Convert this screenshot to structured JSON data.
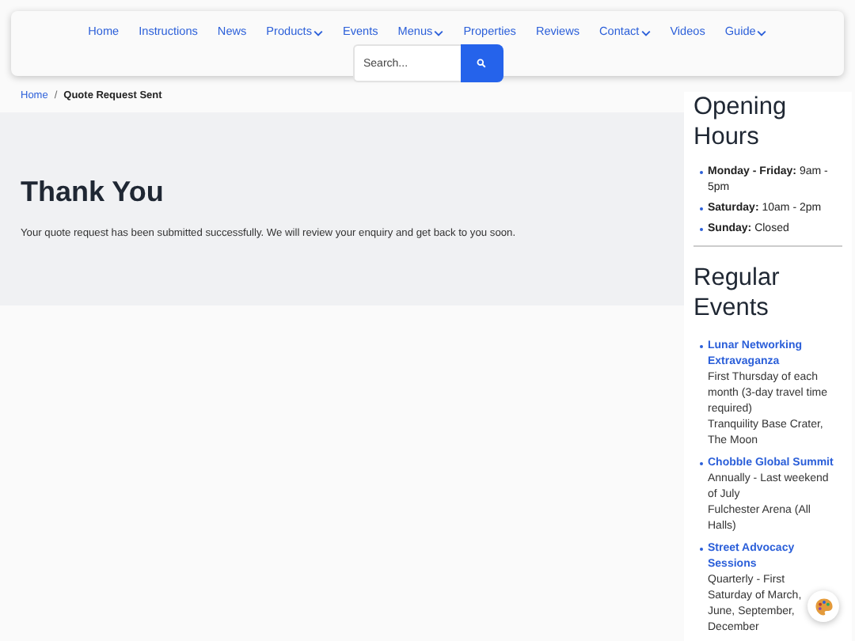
{
  "nav": {
    "items": [
      {
        "label": "Home",
        "dropdown": false
      },
      {
        "label": "Instructions",
        "dropdown": false
      },
      {
        "label": "News",
        "dropdown": false
      },
      {
        "label": "Products",
        "dropdown": true
      },
      {
        "label": "Events",
        "dropdown": false
      },
      {
        "label": "Menus",
        "dropdown": true
      },
      {
        "label": "Properties",
        "dropdown": false
      },
      {
        "label": "Reviews",
        "dropdown": false
      },
      {
        "label": "Contact",
        "dropdown": true
      },
      {
        "label": "Videos",
        "dropdown": false
      },
      {
        "label": "Guide",
        "dropdown": true
      }
    ],
    "search": {
      "placeholder": "Search..."
    }
  },
  "breadcrumb": {
    "items": [
      "Home",
      "Quote Request Sent"
    ],
    "separator": "/"
  },
  "main": {
    "title": "Thank You",
    "message": "Your quote request has been submitted successfully. We will review your enquiry and get back to you soon."
  },
  "sidebar": {
    "opening_hours": {
      "title": "Opening Hours",
      "items": [
        {
          "day": "Monday - Friday:",
          "hours": "9am - 5pm"
        },
        {
          "day": "Saturday:",
          "hours": "10am - 2pm"
        },
        {
          "day": "Sunday:",
          "hours": "Closed"
        }
      ]
    },
    "regular_events": {
      "title": "Regular Events",
      "items": [
        {
          "name": "Lunar Networking Extravaganza",
          "when": "First Thursday of each month (3-day travel time required)",
          "where": "Tranquility Base Crater, The Moon"
        },
        {
          "name": "Chobble Global Summit",
          "when": "Annually - Last weekend of July",
          "where": "Fulchester Arena (All Halls)"
        },
        {
          "name": "Street Advocacy Sessions",
          "when": "Quarterly - First Saturday of March, June, September, December"
        }
      ]
    }
  }
}
